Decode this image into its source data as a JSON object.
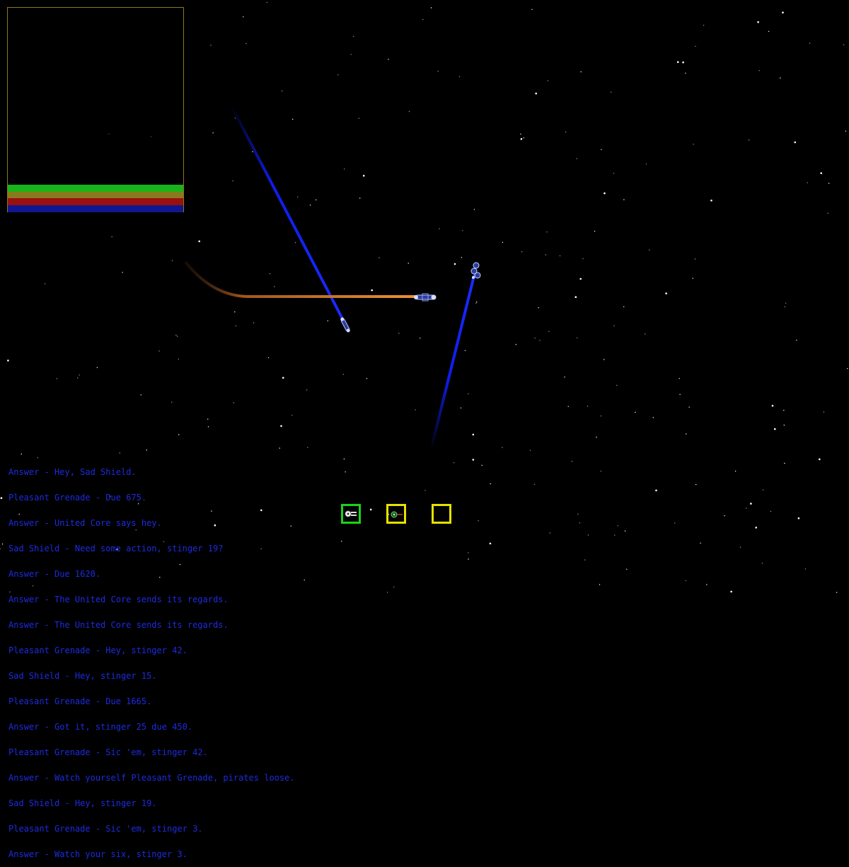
{
  "minimap": {
    "status_bars": [
      {
        "name": "green-bar",
        "color": "#19b419"
      },
      {
        "name": "olive-bar",
        "color": "#8a7a1e"
      },
      {
        "name": "red-bar",
        "color": "#9a1010"
      },
      {
        "name": "blue-bar",
        "color": "#10168f"
      }
    ]
  },
  "chat_log": [
    "Answer - Hey, Sad Shield.",
    "Pleasant Grenade - Due 675.",
    "Answer - United Core says hey.",
    "Sad Shield - Need some action, stinger 19?",
    "Answer - Due 1620.",
    "Answer - The United Core sends its regards.",
    "Answer - The United Core sends its regards.",
    "Pleasant Grenade - Hey, stinger 42.",
    "Sad Shield - Hey, stinger 15.",
    "Pleasant Grenade - Due 1665.",
    "Answer - Got it, stinger 25 due 450.",
    "Pleasant Grenade - Sic 'em, stinger 42.",
    "Answer - Watch yourself Pleasant Grenade, pirates loose.",
    "Sad Shield - Hey, stinger 19.",
    "Pleasant Grenade - Sic 'em, stinger 3.",
    "Answer - Watch your six, stinger 3."
  ],
  "hotbar": {
    "slots": [
      {
        "icon": "ship-icon",
        "selected": true
      },
      {
        "icon": "drone-icon",
        "selected": false
      },
      {
        "icon": "empty",
        "selected": false
      }
    ]
  },
  "colors": {
    "chat_text": "#1d2be0",
    "beam_blue": "#1020ff",
    "beam_orange": "#e8892e",
    "minimap_border": "#8a7a1e",
    "slot_selected": "#19d419",
    "slot_normal": "#e8e000"
  }
}
